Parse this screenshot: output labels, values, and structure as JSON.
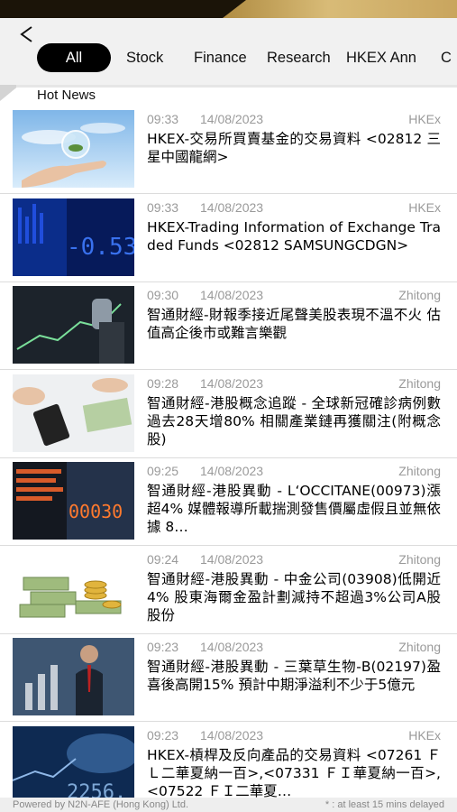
{
  "nav": {
    "tabs": [
      "All",
      "Stock",
      "Finance",
      "Research",
      "HKEX Ann",
      "C"
    ],
    "active_tab": "All"
  },
  "section_label": "Hot News",
  "news": [
    {
      "time": "09:33",
      "date": "14/08/2023",
      "source": "HKEx",
      "title": "HKEX-交易所買賣基金的交易資料 <02812 三星中國龍網>",
      "thumb": "hand-globe"
    },
    {
      "time": "09:33",
      "date": "14/08/2023",
      "source": "HKEx",
      "title": "HKEX-Trading Information of Exchange Traded Funds <02812 SAMSUNGCDGN>",
      "thumb": "stock-board-blue"
    },
    {
      "time": "09:30",
      "date": "14/08/2023",
      "source": "Zhitong",
      "title": "智通財經-財報季接近尾聲美股表現不溫不火 估值高企後市或難言樂觀",
      "thumb": "chart-hand"
    },
    {
      "time": "09:28",
      "date": "14/08/2023",
      "source": "Zhitong",
      "title": "智通財經-港股概念追蹤 - 全球新冠確診病例數過去28天增80% 相關產業鏈再獲關注(附概念股)",
      "thumb": "calculator-money"
    },
    {
      "time": "09:25",
      "date": "14/08/2023",
      "source": "Zhitong",
      "title": "智通財經-港股異動 - L‘OCCITANE(00973)漲超4% 媒體報導所載揣測發售價屬虛假且並無依據 8…",
      "thumb": "stock-board-orange"
    },
    {
      "time": "09:24",
      "date": "14/08/2023",
      "source": "Zhitong",
      "title": "智通財經-港股異動 - 中金公司(03908)低開近4% 股東海爾金盈計劃減持不超過3%公司A股股份",
      "thumb": "money-coins"
    },
    {
      "time": "09:23",
      "date": "14/08/2023",
      "source": "Zhitong",
      "title": "智通財經-港股異動 - 三葉草生物-B(02197)盈喜後高開15% 預計中期淨溢利不少于5億元",
      "thumb": "businessman-chart"
    },
    {
      "time": "09:23",
      "date": "14/08/2023",
      "source": "HKEx",
      "title": "HKEX-槓桿及反向產品的交易資料 <07261 ＦＬ二華夏納一百>,<07331 ＦＩ華夏納一百>,<07522 ＦＩ二華夏…",
      "thumb": "stock-numbers-blue"
    }
  ],
  "footer": {
    "powered_by": "Powered by N2N-AFE (Hong Kong) Ltd.",
    "delay_note": "* : at least 15 mins delayed"
  }
}
